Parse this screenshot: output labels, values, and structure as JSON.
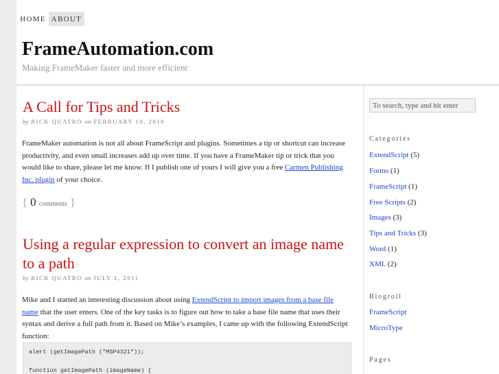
{
  "nav": {
    "home": "HOME",
    "about": "ABOUT"
  },
  "site": {
    "title": "FrameAutomation.com",
    "description": "Making FrameMaker faster and more efficient"
  },
  "posts": [
    {
      "title": "A Call for Tips and Tricks",
      "by": "by",
      "author": "RICK QUATRO",
      "on": "on",
      "date": "FEBRUARY 10, 2010",
      "body_parts": [
        "FrameMaker automation is not all about FrameScript and plugins. Sometimes a tip or shortcut can increase productivity, and even small increases add up over time. If you have a FrameMaker tip or trick that you would like to share, please let me know. If I publish one of yours I will give you a free ",
        "Carmen Publishing Inc. plugin",
        " of your choice."
      ],
      "comments_open": "{",
      "comments_count": "0",
      "comments_label": "comments",
      "comments_close": "}"
    },
    {
      "title": "Using a regular expression to convert an image name to a path",
      "by": "by",
      "author": "RICK QUATRO",
      "on": "on",
      "date": "JULY 1, 2011",
      "body_parts": [
        "Mike and I started an interesting discussion about using ",
        "ExtendScript to import images from a base file name",
        " that the user enters. One of the key tasks is to figure out how to take a base file name that uses their syntax and derive a full path from it. Based on Mike’s examples, I came up with the following ExtendScript function:"
      ],
      "code_lines": [
        "alert (getImagePath (\"MSP4321\"));",
        "function getImagePath (imageName) {"
      ]
    }
  ],
  "sidebar": {
    "search_placeholder": "To search, type and hit enter",
    "categories_heading": "Categories",
    "categories": [
      {
        "name": "ExtendScript",
        "count": "(5)"
      },
      {
        "name": "Forms",
        "count": "(1)"
      },
      {
        "name": "FrameScript",
        "count": "(1)"
      },
      {
        "name": "Free Scripts",
        "count": "(2)"
      },
      {
        "name": "Images",
        "count": "(3)"
      },
      {
        "name": "Tips and Tricks",
        "count": "(3)"
      },
      {
        "name": "Word",
        "count": "(1)"
      },
      {
        "name": "XML",
        "count": "(2)"
      }
    ],
    "blogroll_heading": "Blogroll",
    "blogroll": [
      "FrameScript",
      "MicroType"
    ],
    "pages_heading": "Pages"
  },
  "colors": {
    "title_red": "#cc1111",
    "link_blue": "#1a44cc",
    "background": "#eeeeee"
  }
}
